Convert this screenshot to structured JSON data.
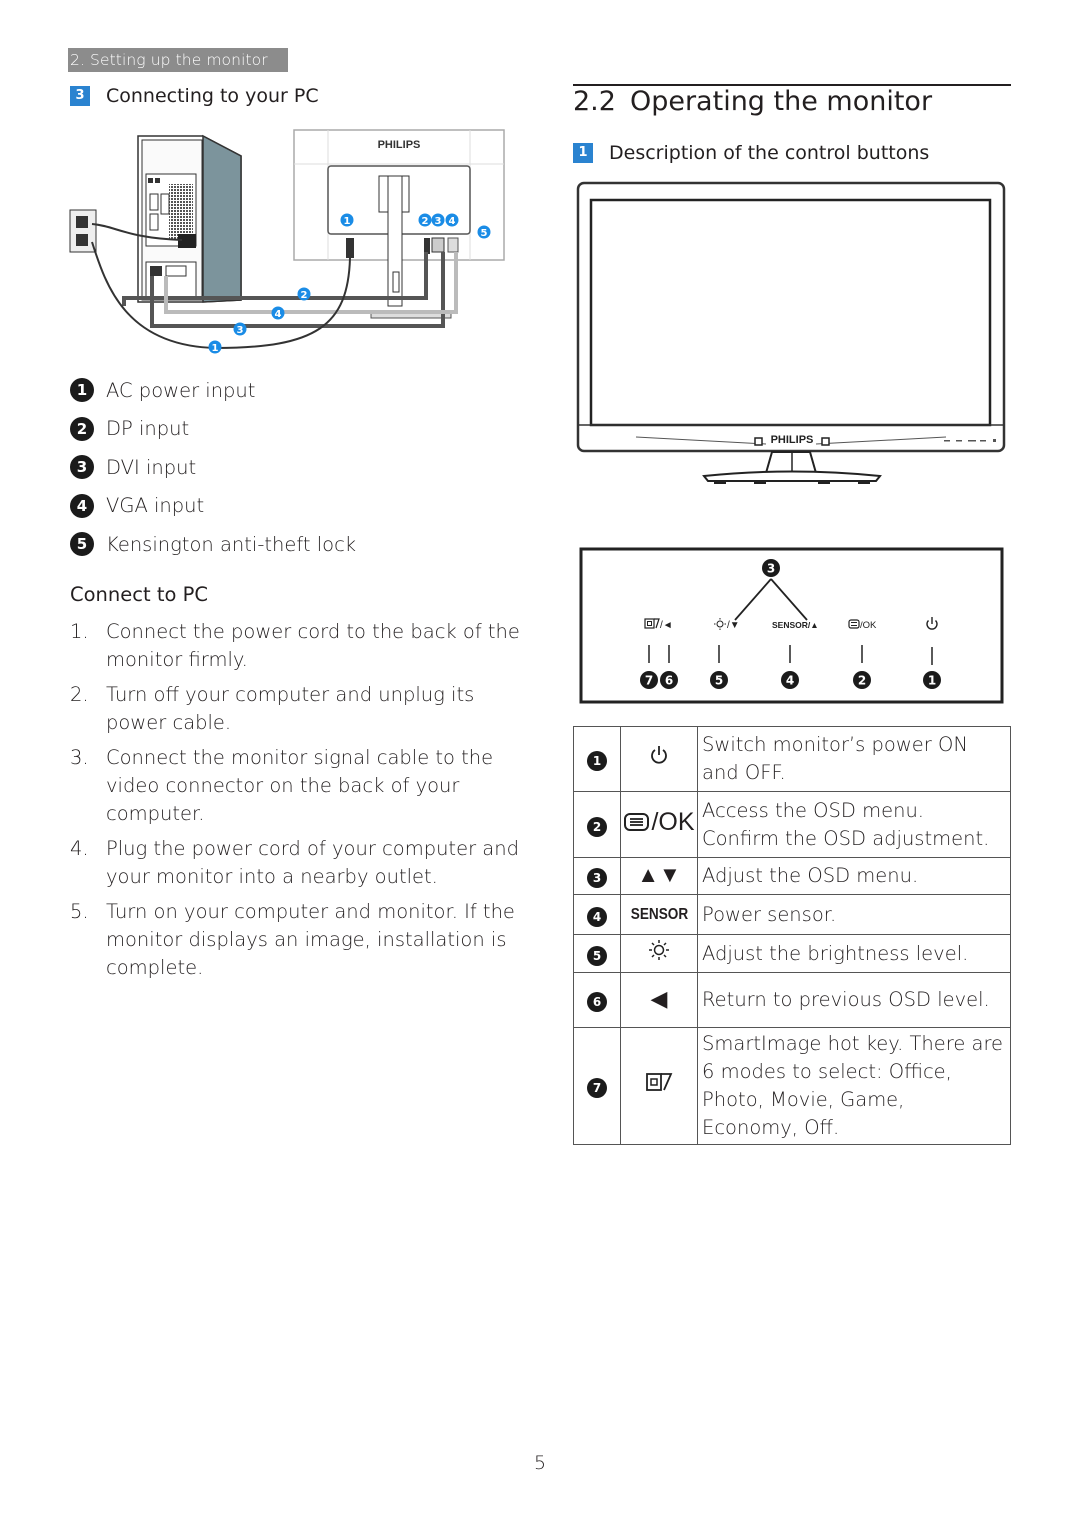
{
  "header": {
    "section_tag": "2. Setting up the monitor"
  },
  "left": {
    "subsection": {
      "badge": "3",
      "title": "Connecting to your PC"
    },
    "diagram": {
      "brand": "PHILIPS",
      "callouts": [
        "1",
        "2",
        "3",
        "4",
        "5"
      ],
      "accent_color": "#1a8ce6"
    },
    "legend": [
      {
        "num": "1",
        "label": "AC power input"
      },
      {
        "num": "2",
        "label": "DP input"
      },
      {
        "num": "3",
        "label": "DVI input"
      },
      {
        "num": "4",
        "label": "VGA input"
      },
      {
        "num": "5",
        "label": "Kensington anti-theft lock"
      }
    ],
    "connect_title": "Connect to PC",
    "steps": [
      {
        "num": "1.",
        "text": "Connect the power cord to the back of the monitor firmly."
      },
      {
        "num": "2.",
        "text": "Turn off your computer and unplug its power cable."
      },
      {
        "num": "3.",
        "text": "Connect the monitor signal cable to the video connector on the back of your computer."
      },
      {
        "num": "4.",
        "text": "Plug the power cord of your computer and your monitor into a nearby outlet."
      },
      {
        "num": "5.",
        "text": "Turn on your computer and monitor. If the monitor displays an image, installation is complete."
      }
    ]
  },
  "right": {
    "section_number": "2.2",
    "section_title": "Operating the monitor",
    "subsection": {
      "badge": "1",
      "title": "Description of the control buttons"
    },
    "monitor_front": {
      "brand": "PHILIPS"
    },
    "button_panel": {
      "top_callout": "3",
      "buttons": [
        {
          "label": "/◄",
          "icon": "smartimage-icon",
          "callouts": [
            "7",
            "6"
          ]
        },
        {
          "label": "/▼",
          "icon": "brightness-icon",
          "callouts": [
            "5"
          ]
        },
        {
          "label": "SENSOR/▲",
          "icon": "",
          "callouts": [
            "4"
          ]
        },
        {
          "label": "/OK",
          "icon": "menu-icon",
          "callouts": [
            "2"
          ]
        },
        {
          "label": "",
          "icon": "power-icon",
          "callouts": [
            "1"
          ]
        }
      ]
    },
    "control_table": [
      {
        "num": "1",
        "icon": "power-icon",
        "icon_text": "",
        "description": "Switch monitor’s power ON and OFF."
      },
      {
        "num": "2",
        "icon": "menu-icon",
        "icon_text": "/OK",
        "description": "Access the OSD menu. Confirm the OSD adjustment."
      },
      {
        "num": "3",
        "icon": "up-down-arrows-icon",
        "icon_text": "▲▼",
        "description": "Adjust the OSD menu."
      },
      {
        "num": "4",
        "icon": "sensor-label",
        "icon_text": "SENSOR",
        "description": "Power sensor."
      },
      {
        "num": "5",
        "icon": "brightness-icon",
        "icon_text": "",
        "description": "Adjust the brightness level."
      },
      {
        "num": "6",
        "icon": "left-arrow-icon",
        "icon_text": "◀",
        "description": "Return to previous OSD level."
      },
      {
        "num": "7",
        "icon": "smartimage-icon",
        "icon_text": "",
        "description": "SmartImage hot key. There are 6 modes to select: Office, Photo, Movie, Game, Economy, Off."
      }
    ]
  },
  "footer": {
    "page_number": "5"
  }
}
